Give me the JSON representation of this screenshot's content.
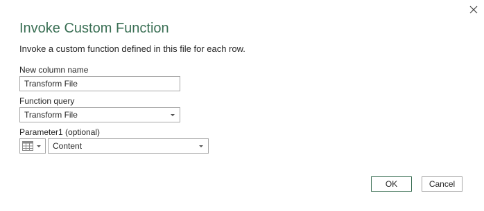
{
  "dialog": {
    "title": "Invoke Custom Function",
    "description": "Invoke a custom function defined in this file for each row."
  },
  "fields": {
    "new_column_name": {
      "label": "New column name",
      "value": "Transform File"
    },
    "function_query": {
      "label": "Function query",
      "value": "Transform File"
    },
    "parameter1": {
      "label": "Parameter1 (optional)",
      "value": "Content",
      "type_icon": "table-column-icon"
    }
  },
  "buttons": {
    "ok": "OK",
    "cancel": "Cancel"
  },
  "colors": {
    "accent": "#3a6f54",
    "border": "#a6a6a6",
    "text": "#262626"
  },
  "icons": {
    "close": "close-icon"
  }
}
